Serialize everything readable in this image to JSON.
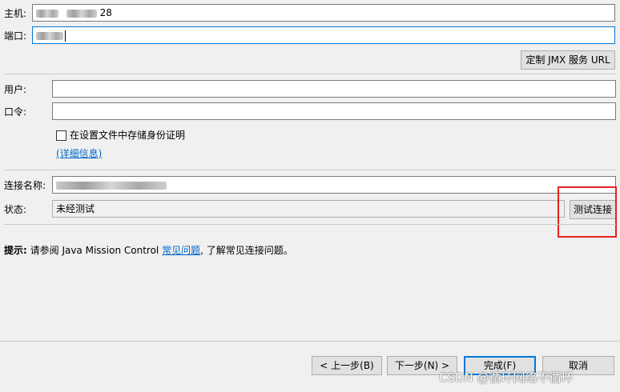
{
  "host": {
    "label": "主机:",
    "value_suffix": "28"
  },
  "port": {
    "label": "端口:"
  },
  "jmx": {
    "label": "定制 JMX 服务 URL"
  },
  "user": {
    "label": "用户:",
    "value": ""
  },
  "password": {
    "label": "口令:",
    "value": ""
  },
  "store_credentials": {
    "label": "在设置文件中存储身份证明",
    "checked": false
  },
  "details_link": "(详细信息)",
  "connection_name": {
    "label": "连接名称:"
  },
  "status": {
    "label": "状态:",
    "value": "未经测试"
  },
  "test_button": "测试连接",
  "hint": {
    "prefix": "提示:",
    "text_before": " 请参阅 Java Mission Control ",
    "link": "常见问题",
    "text_after": ", 了解常见连接问题。"
  },
  "footer": {
    "back": "< 上一步(B)",
    "next": "下一步(N) >",
    "finish": "完成(F)",
    "cancel": "取消"
  },
  "watermark": "CSDN @循环网络不循环",
  "colors": {
    "accent": "#0078d7",
    "highlight": "#e4231b",
    "link": "#0066cc"
  }
}
